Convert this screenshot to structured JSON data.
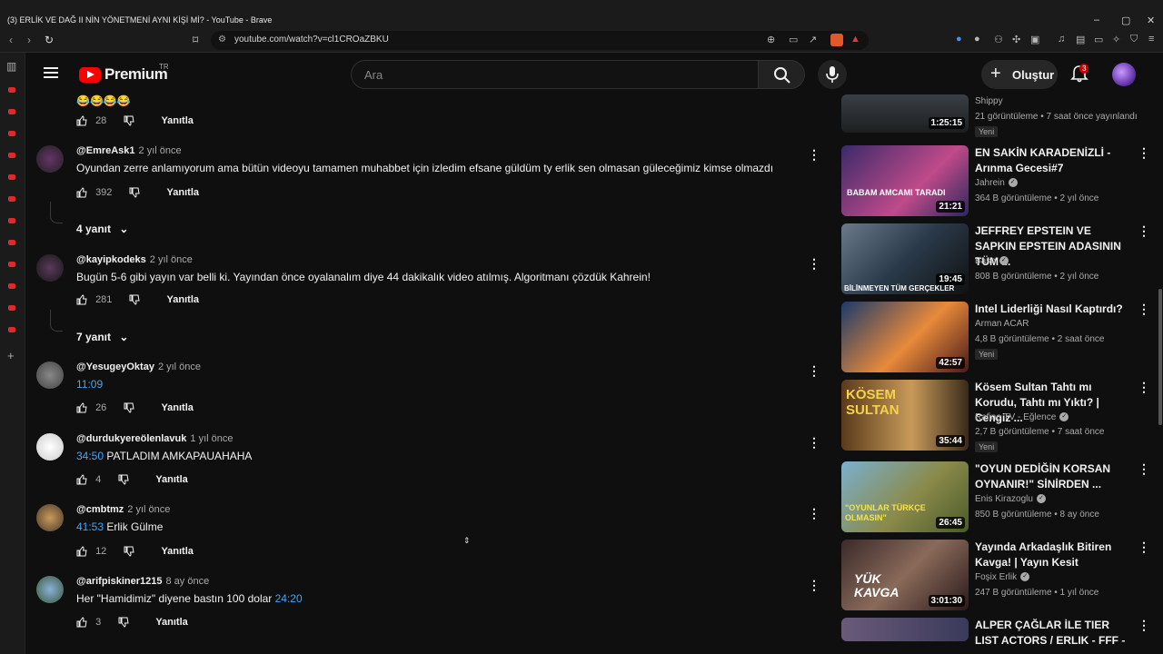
{
  "window": {
    "title": "(3) ERLİK VE DAĞ II NİN YÖNETMENİ AYNI KİŞİ Mİ? - YouTube - Brave"
  },
  "browser": {
    "url": "youtube.com/watch?v=cl1CROaZBKU"
  },
  "header": {
    "logo_text": "Premium",
    "country_code": "TR",
    "search_placeholder": "Ara",
    "create_label": "Oluştur",
    "notification_count": "3"
  },
  "comments": [
    {
      "emojis": "😂😂😂😂",
      "likes": "28",
      "reply_label": "Yanıtla"
    },
    {
      "author": "@EmreAsk1",
      "time": "2 yıl önce",
      "text": "Oyundan zerre anlamıyorum ama bütün videoyu tamamen muhabbet için izledim efsane güldüm ty erlik sen olmasan güleceğimiz kimse olmazdı",
      "likes": "392",
      "reply_label": "Yanıtla",
      "replies": "4 yanıt"
    },
    {
      "author": "@kayipkodeks",
      "time": "2 yıl önce",
      "text": "Bugün 5-6 gibi yayın var belli ki. Yayından önce oyalanalım diye 44 dakikalık video atılmış. Algoritmanı çözdük Kahrein!",
      "likes": "281",
      "reply_label": "Yanıtla",
      "replies": "7 yanıt"
    },
    {
      "author": "@YesugeyOktay",
      "time": "2 yıl önce",
      "timestamp": "11:09",
      "text": "",
      "likes": "26",
      "reply_label": "Yanıtla"
    },
    {
      "author": "@durdukyereölenlavuk",
      "time": "1 yıl önce",
      "timestamp": "34:50",
      "text": " PATLADIM AMKAPAUAHAHA",
      "likes": "4",
      "reply_label": "Yanıtla"
    },
    {
      "author": "@cmbtmz",
      "time": "2 yıl önce",
      "timestamp": "41:53",
      "text": " Erlik Gülme",
      "likes": "12",
      "reply_label": "Yanıtla"
    },
    {
      "author": "@arifpiskiner1215",
      "time": "8 ay önce",
      "text": "Her \"Hamidimiz\" diyene bastın 100 dolar ",
      "timestamp": "24:20",
      "likes": "3",
      "reply_label": "Yanıtla"
    }
  ],
  "videos": [
    {
      "title": "",
      "channel": "Shippy",
      "meta": "21 görüntüleme • 7 saat önce yayınlandı",
      "badge": "Yeni",
      "duration": "1:25:15"
    },
    {
      "title": "EN SAKİN KARADENİZLİ - Arınma Gecesi#7",
      "channel": "Jahrein",
      "meta": "364 B görüntüleme • 2 yıl önce",
      "duration": "21:21",
      "thumb_text": "BABAM AMCAMI TARADI"
    },
    {
      "title": "JEFFREY EPSTEIN VE SAPKIN EPSTEIN ADASININ TÜM ...",
      "channel": "Baso",
      "meta": "808 B görüntüleme • 2 yıl önce",
      "duration": "19:45",
      "thumb_text": "BİLİNMEYEN TÜM GERÇEKLER"
    },
    {
      "title": "Intel Liderliği Nasıl Kaptırdı?",
      "channel": "Arman ACAR",
      "meta": "4,8 B görüntüleme • 2 saat önce",
      "badge": "Yeni",
      "duration": "42:57"
    },
    {
      "title": "Kösem Sultan Tahtı mı Korudu, Tahtı mı Yıktı? | Cengiz ...",
      "channel": "Rafine TV - Eğlence",
      "meta": "2,7 B görüntüleme • 7 saat önce",
      "badge": "Yeni",
      "duration": "35:44",
      "thumb_text": "KÖSEM SULTAN"
    },
    {
      "title": "\"OYUN DEDİĞİN KORSAN OYNANIR!\" SİNİRDEN ...",
      "channel": "Enis Kirazoglu",
      "meta": "850 B görüntüleme • 8 ay önce",
      "duration": "26:45",
      "thumb_text": "\"OYUNLAR TÜRKÇE OLMASIN\""
    },
    {
      "title": "Yayında Arkadaşlık Bitiren Kavga! | Yayın Kesit",
      "channel": "Foşix Erlik",
      "meta": "247 B görüntüleme • 1 yıl önce",
      "duration": "3:01:30",
      "thumb_text": "YÜK KAVGA"
    },
    {
      "title": "ALPER ÇAĞLAR İLE TIER LIST ACTORS / ERLIK - FFF -",
      "channel": "",
      "meta": ""
    }
  ],
  "colors": {
    "bg": "#0f0f0f",
    "link": "#3ea6ff",
    "brand": "#ff0000"
  }
}
